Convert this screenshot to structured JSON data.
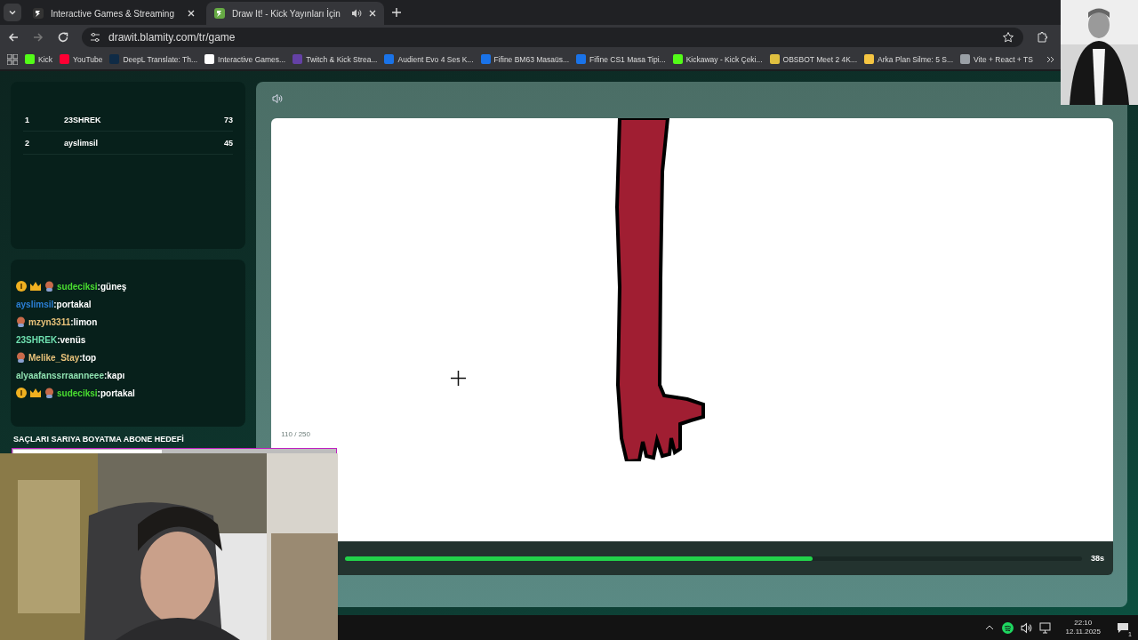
{
  "browser": {
    "tabs": [
      {
        "title": "Interactive Games & Streaming",
        "selected": false,
        "audio": false
      },
      {
        "title": "Draw It! - Kick Yayınları İçin",
        "selected": true,
        "audio": true
      }
    ],
    "url": "drawit.blamity.com/tr/game",
    "bookmarks": [
      {
        "label": "Kick",
        "color": "#53fc18"
      },
      {
        "label": "YouTube",
        "color": "#ff0033"
      },
      {
        "label": "DeepL Translate: Th...",
        "color": "#0f2b46"
      },
      {
        "label": "Interactive Games...",
        "color": "#ffffff"
      },
      {
        "label": "Twitch & Kick Strea...",
        "color": "#6441a5"
      },
      {
        "label": "Audient Evo 4 Ses K...",
        "color": "#1a73e8"
      },
      {
        "label": "Fifine BM63 Masaüs...",
        "color": "#1a73e8"
      },
      {
        "label": "Fifine CS1 Masa Tipi...",
        "color": "#1a73e8"
      },
      {
        "label": "Kickaway - Kick Çeki...",
        "color": "#53fc18"
      },
      {
        "label": "OBSBOT Meet 2 4K...",
        "color": "#e0c040"
      },
      {
        "label": "Arka Plan Silme: 5 S...",
        "color": "#f5c542"
      },
      {
        "label": "Vite + React + TS",
        "color": "#9aa0a6"
      }
    ]
  },
  "leaderboard": [
    {
      "rank": "1",
      "name": "23SHREK",
      "score": "73"
    },
    {
      "rank": "2",
      "name": "ayslimsil",
      "score": "45"
    }
  ],
  "chat": [
    {
      "kind": "vip",
      "user": "sudeciksi",
      "color": "#4ade30",
      "text": ":güneş"
    },
    {
      "kind": "plain",
      "user": "ayslimsil",
      "color": "#2b7fd6",
      "text": ":portakal"
    },
    {
      "kind": "avatar",
      "user": "mzyn3311",
      "color": "#e8c27a",
      "text": ":limon"
    },
    {
      "kind": "plain",
      "user": "23SHREK",
      "color": "#6fe0b0",
      "text": ":venüs"
    },
    {
      "kind": "avatar",
      "user": "Melike_Stay",
      "color": "#e8c27a",
      "text": ":top"
    },
    {
      "kind": "plain",
      "user": "alyaafanssrraanneee",
      "color": "#8fe0b0",
      "text": ":kapı"
    },
    {
      "kind": "vip",
      "user": "sudeciksi",
      "color": "#4ade30",
      "text": ":portakal"
    }
  ],
  "goal": {
    "title": "SAÇLARI SARIYA BOYATMA ABONE HEDEFİ",
    "count": "110 / 250",
    "level": 0.46
  },
  "game": {
    "timer": {
      "level": 0.635,
      "reading": "38s"
    }
  },
  "taskbar": {
    "time": "22:10",
    "date": "12.11.2025",
    "notifications": "1"
  }
}
